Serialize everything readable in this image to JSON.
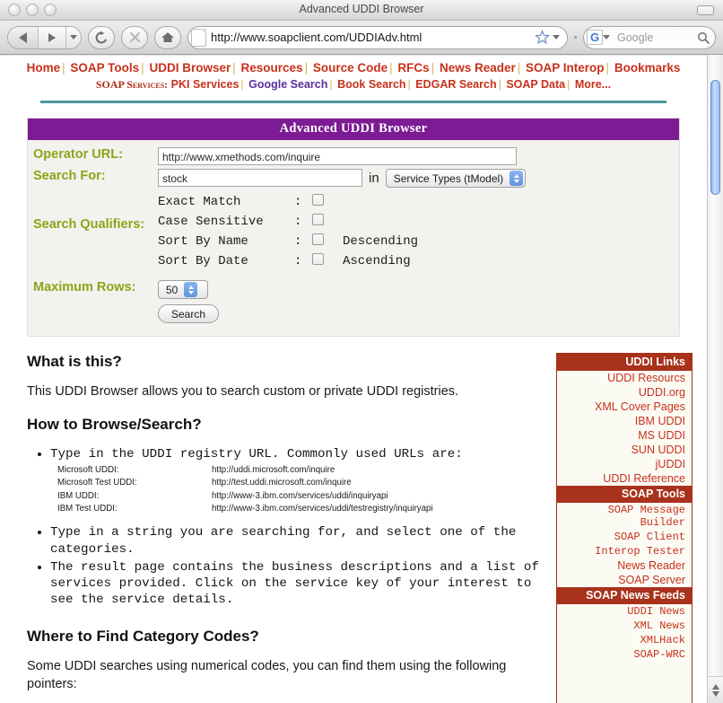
{
  "window": {
    "title": "Advanced UDDI Browser"
  },
  "toolbar": {
    "url": "http://www.soapclient.com/UDDIAdv.html",
    "search_placeholder": "Google",
    "search_engine_letter": "G",
    "back_label": "Back",
    "forward_label": "Forward",
    "reload_label": "Reload",
    "stop_label": "Stop",
    "home_label": "Home"
  },
  "sitenav": {
    "primary": [
      "Home",
      "SOAP Tools",
      "UDDI Browser",
      "Resources",
      "Source Code",
      "RFCs",
      "News Reader",
      "SOAP Interop",
      "Bookmarks"
    ],
    "secondary_label": "SOAP Services:",
    "secondary": [
      {
        "label": "PKI Services",
        "style": "red"
      },
      {
        "label": "Google Search",
        "style": "purple"
      },
      {
        "label": "Book Search",
        "style": "red"
      },
      {
        "label": "EDGAR Search",
        "style": "red"
      },
      {
        "label": "SOAP Data",
        "style": "red"
      },
      {
        "label": "More...",
        "style": "red"
      }
    ],
    "separator": "|"
  },
  "form": {
    "panel_title": "Advanced UDDI  Browser",
    "operator_url_label": "Operator URL:",
    "operator_url_value": "http://www.xmethods.com/inquire",
    "search_for_label": "Search For:",
    "search_for_value": "stock",
    "in_word": "in",
    "category_selected": "Service Types (tModel)",
    "qualifiers_label": "Search Qualifiers:",
    "qualifiers": [
      {
        "name": "Exact Match  ",
        "colon": ":",
        "checked": false,
        "extra": ""
      },
      {
        "name": "Case Sensitive",
        "colon": ":",
        "checked": false,
        "extra": ""
      },
      {
        "name": "Sort By Name ",
        "colon": ":",
        "checked": false,
        "extra": "Descending"
      },
      {
        "name": "Sort By Date ",
        "colon": ":",
        "checked": false,
        "extra": "Ascending"
      }
    ],
    "max_rows_label": "Maximum Rows:",
    "max_rows_value": "50",
    "search_button": "Search"
  },
  "article": {
    "h_what": "What is this?",
    "p_what": "This UDDI Browser allows you to search custom or private UDDI registries.",
    "h_how": "How to Browse/Search?",
    "bullet1": "Type in the UDDI registry URL. Commonly used URLs are:",
    "registries": [
      {
        "name": "Microsoft UDDI:",
        "url": "http://uddi.microsoft.com/inquire"
      },
      {
        "name": "Microsoft Test UDDI:",
        "url": "http://test.uddi.microsoft.com/inquire"
      },
      {
        "name": "IBM UDDI:",
        "url": "http://www-3.ibm.com/services/uddi/inquiryapi"
      },
      {
        "name": "IBM Test UDDI:",
        "url": "http://www-3.ibm.com/services/uddi/testregistry/inquiryapi"
      }
    ],
    "bullet2": "Type in a string you are searching for, and select one of the categories.",
    "bullet3": "The result page contains the business descriptions and a list of services provided. Click on the service key of your interest to see the service details.",
    "h_where": "Where to Find Category Codes?",
    "p_where": "Some UDDI searches using numerical codes, you can find them using the following pointers:"
  },
  "sidebar": {
    "sections": [
      {
        "title": "UDDI Links",
        "font": "sans",
        "links": [
          "UDDI Resourcs",
          "UDDI.org",
          "XML Cover Pages",
          "IBM UDDI",
          "MS UDDI",
          "SUN UDDI",
          "jUDDI",
          "UDDI Reference"
        ]
      },
      {
        "title": "SOAP Tools",
        "font": "mixed",
        "links": [
          "SOAP Message Builder",
          "SOAP Client",
          "Interop Tester",
          "News Reader",
          "SOAP Server"
        ]
      },
      {
        "title": "SOAP News Feeds",
        "font": "mono",
        "links": [
          "UDDI News",
          "XML News",
          "XMLHack",
          "SOAP-WRC"
        ]
      }
    ]
  },
  "colors": {
    "panel_header_purple": "#7d1b94",
    "label_olive": "#8aa617",
    "nav_red": "#c8301a",
    "nav_purple": "#5b2f9e",
    "pipe_gold": "#d6b64f",
    "teal_rule": "#4c9a9a",
    "sidebar_header": "#a8321c",
    "sidebar_bg": "#fbfbf4",
    "panel_bg": "#f2f2ee",
    "scrollbar_thumb": "#8ab2ef"
  }
}
